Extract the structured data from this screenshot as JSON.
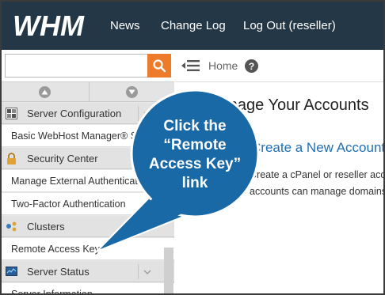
{
  "header": {
    "logo_text": "WHM",
    "nav": [
      {
        "label": "News"
      },
      {
        "label": "Change Log"
      },
      {
        "label": "Log Out (reseller)"
      }
    ],
    "background": "#243746"
  },
  "sidebar": {
    "search": {
      "value": "",
      "placeholder": ""
    },
    "search_button_color": "#ee7a2c",
    "sections": [
      {
        "label": "Server Configuration",
        "icon": "server-config-icon"
      },
      {
        "label": "Security Center",
        "icon": "lock-icon"
      },
      {
        "label": "Clusters",
        "icon": "clusters-icon"
      },
      {
        "label": "Server Status",
        "icon": "monitor-icon"
      }
    ],
    "items": [
      {
        "label": "Basic WebHost Manager® Setup"
      },
      {
        "label": "Manage External Authentications"
      },
      {
        "label": "Two-Factor Authentication"
      },
      {
        "label": "Remote Access Key"
      },
      {
        "label": "Server Information"
      }
    ]
  },
  "breadcrumb": {
    "home": "Home",
    "help": "?"
  },
  "main": {
    "title": "Manage Your Accounts",
    "subtitle": "Create a New Account",
    "desc_line1": "Create a cPanel or reseller account.",
    "desc_line2": "accounts can manage domains"
  },
  "callout": {
    "line1": "Click the",
    "line2": "“Remote",
    "line3": "Access Key”",
    "line4": "link",
    "color": "#1a69a7"
  }
}
